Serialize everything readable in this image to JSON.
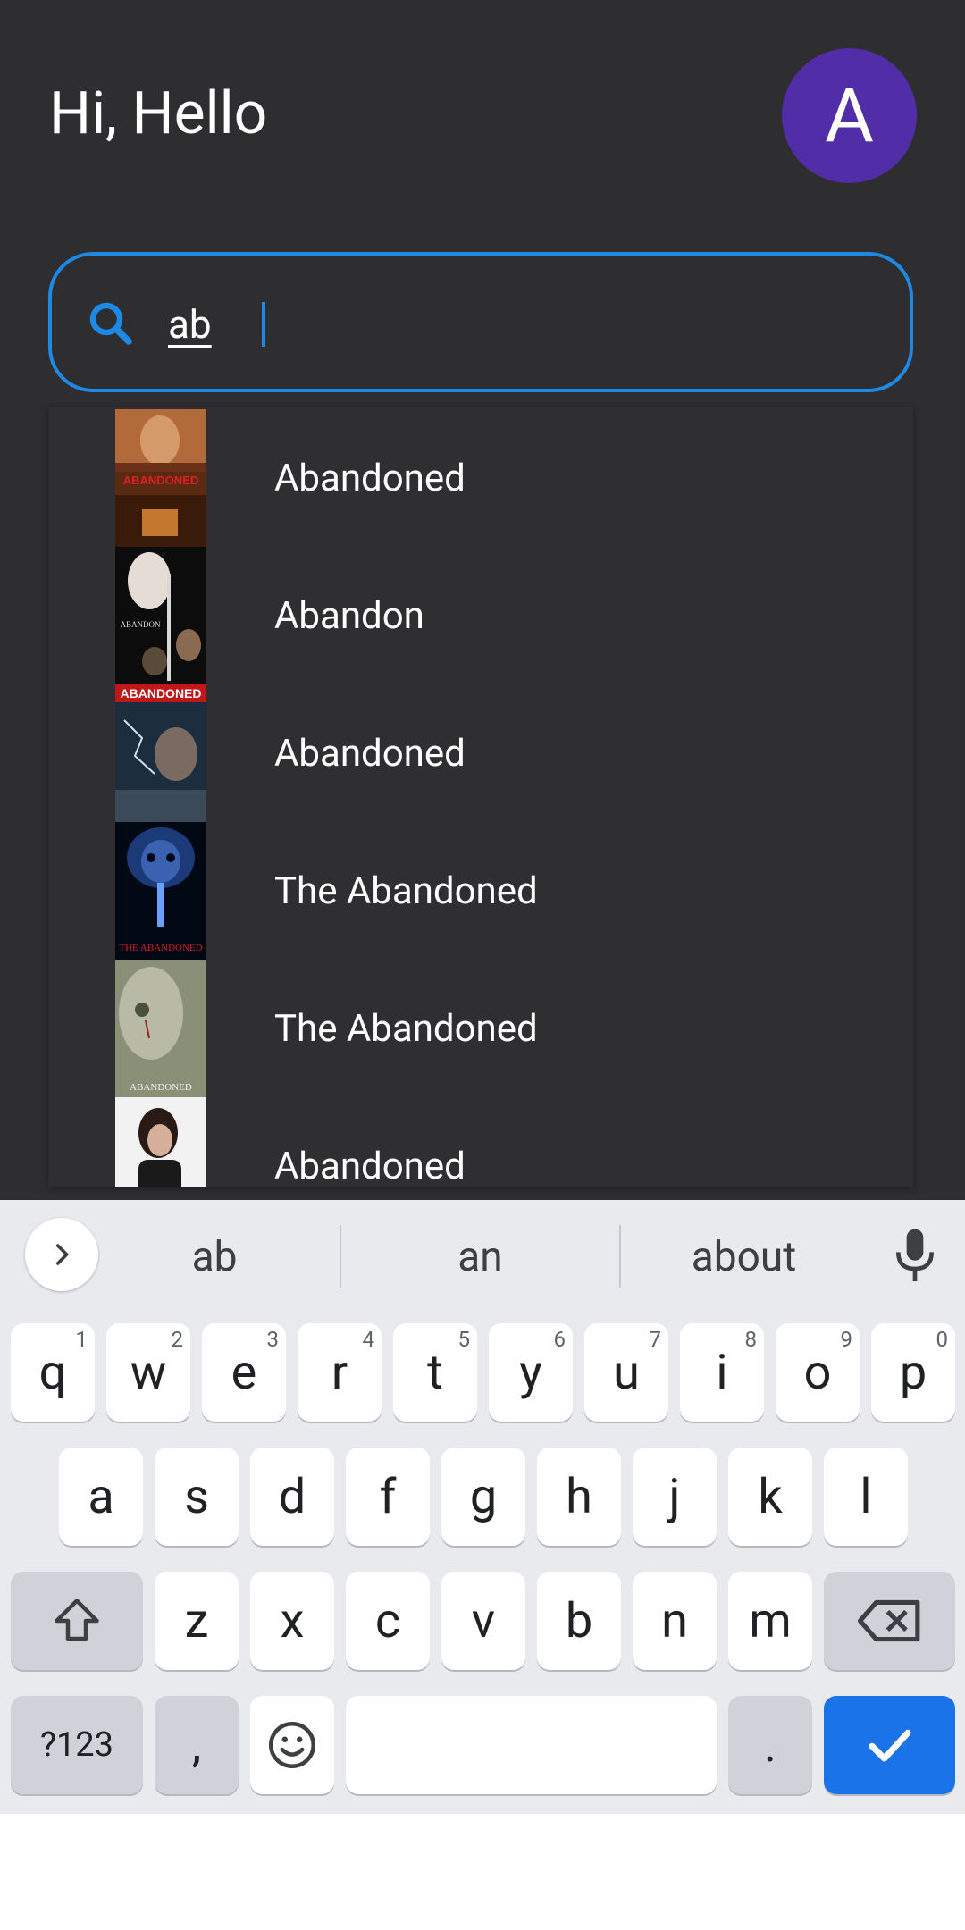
{
  "header": {
    "greeting": "Hi, Hello",
    "avatar_letter": "A"
  },
  "search": {
    "value": "ab",
    "icon": "search-icon"
  },
  "results": [
    {
      "title": "Abandoned",
      "poster_text": "ABANDONED"
    },
    {
      "title": "Abandon",
      "poster_text": "ABANDON"
    },
    {
      "title": "Abandoned",
      "poster_text": "ABANDONED"
    },
    {
      "title": "The Abandoned",
      "poster_text": "THE ABANDONED"
    },
    {
      "title": "The Abandoned",
      "poster_text": "ABANDONED"
    },
    {
      "title": "Abandoned",
      "poster_text": ""
    }
  ],
  "keyboard": {
    "suggestions": [
      "ab",
      "an",
      "about"
    ],
    "row1": [
      {
        "label": "q",
        "hint": "1"
      },
      {
        "label": "w",
        "hint": "2"
      },
      {
        "label": "e",
        "hint": "3"
      },
      {
        "label": "r",
        "hint": "4"
      },
      {
        "label": "t",
        "hint": "5"
      },
      {
        "label": "y",
        "hint": "6"
      },
      {
        "label": "u",
        "hint": "7"
      },
      {
        "label": "i",
        "hint": "8"
      },
      {
        "label": "o",
        "hint": "9"
      },
      {
        "label": "p",
        "hint": "0"
      }
    ],
    "row2": [
      "a",
      "s",
      "d",
      "f",
      "g",
      "h",
      "j",
      "k",
      "l"
    ],
    "row3": [
      "z",
      "x",
      "c",
      "v",
      "b",
      "n",
      "m"
    ],
    "symbols_label": "?123",
    "comma_label": ",",
    "period_label": "."
  },
  "colors": {
    "accent": "#1e88e5",
    "avatar": "#512da8",
    "background": "#2e2e30",
    "enter_key": "#1a73e8"
  }
}
